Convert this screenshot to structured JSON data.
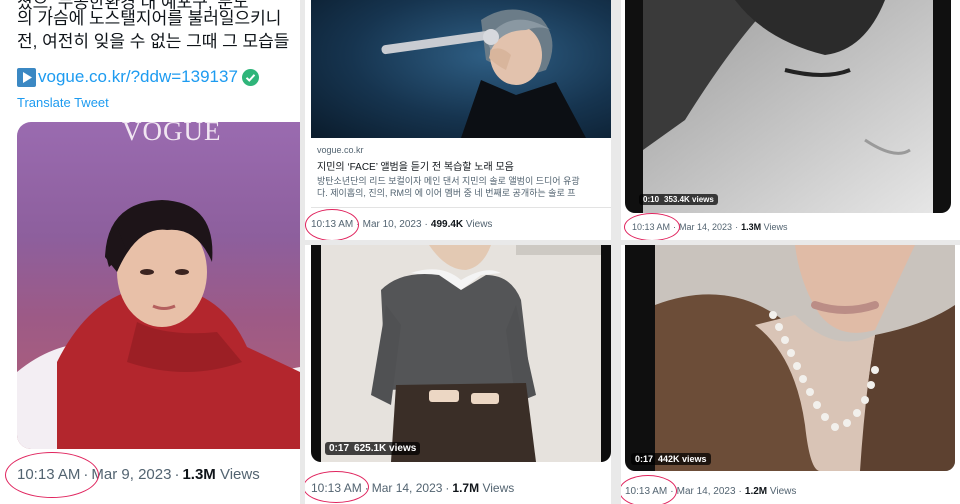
{
  "panel1": {
    "korean_lines": [
      "의 가슴에 노스탤지어를 불러일으키니",
      "전, 여전히 잊을 수 없는 그때 그 모습들"
    ],
    "link_text": "vogue.co.kr/?ddw=139137",
    "translate": "Translate Tweet",
    "magazine_logo": "VOGUE",
    "time": "10:13 AM",
    "date": "Mar 9, 2023",
    "views_count": "1.3M",
    "views_label": "Views"
  },
  "panel2": {
    "card_domain": "vogue.co.kr",
    "card_title": "지민의 ‘FACE’ 앨범을 듣기 전 복습할 노래 모음",
    "card_desc_1": "방탄소년단의 리드 보컬이자 메인 댄서 지민의 솔로 앨범이 드디어 유광",
    "card_desc_2": "다. 제이홉의, 진의, RM의 에 이어 멤버 중 네 번째로 공개하는 솔로 프",
    "time": "10:13 AM",
    "date": "Mar 10, 2023",
    "views_count": "499.4K",
    "views_label": "Views"
  },
  "panel3": {
    "duration": "0:10",
    "video_views": "353.4K views",
    "time": "10:13 AM",
    "date": "Mar 14, 2023",
    "views_count": "1.3M",
    "views_label": "Views"
  },
  "panel4": {
    "duration": "0:17",
    "video_views": "625.1K views",
    "time": "10:13 AM",
    "date": "Mar 14, 2023",
    "views_count": "1.7M",
    "views_label": "Views"
  },
  "panel5": {
    "duration": "0:17",
    "video_views": "442K views",
    "time": "10:13 AM",
    "date": "Mar 14, 2023",
    "views_count": "1.2M",
    "views_label": "Views"
  },
  "colors": {
    "link": "#1d9bf0",
    "verified": "#2fb57a",
    "circle": "#e0245e",
    "muted": "#536471"
  }
}
